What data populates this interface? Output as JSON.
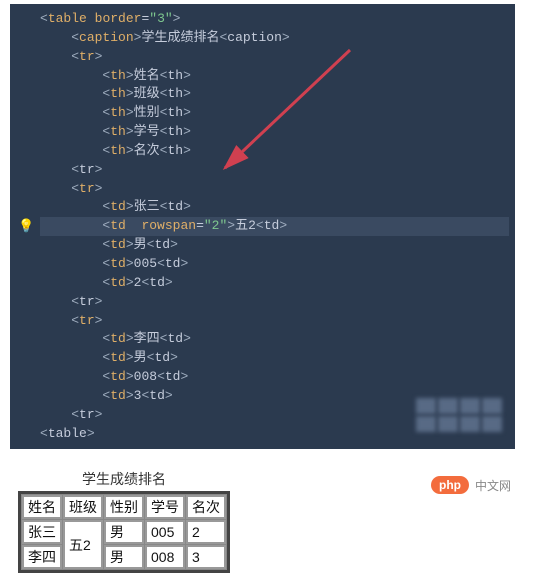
{
  "code": {
    "lines": [
      {
        "indent": 0,
        "html": "<_a><_t>table</_t> <_at>border</_at><_eq>=</_eq><_s>\"3\"</_s><_a2>"
      },
      {
        "indent": 1,
        "html": "<_a><_t>caption</_t><_a2><_x>学生成绩排名</_x><_a></<_t>caption</_t><_a2>"
      },
      {
        "indent": 1,
        "html": "<_a><_t>tr</_t><_a2>"
      },
      {
        "indent": 2,
        "html": "<_a><_t>th</_t><_a2><_x>姓名</_x><_a></<_t>th</_t><_a2>"
      },
      {
        "indent": 2,
        "html": "<_a><_t>th</_t><_a2><_x>班级</_x><_a></<_t>th</_t><_a2>"
      },
      {
        "indent": 2,
        "html": "<_a><_t>th</_t><_a2><_x>性别</_x><_a></<_t>th</_t><_a2>"
      },
      {
        "indent": 2,
        "html": "<_a><_t>th</_t><_a2><_x>学号</_x><_a></<_t>th</_t><_a2>"
      },
      {
        "indent": 2,
        "html": "<_a><_t>th</_t><_a2><_x>名次</_x><_a></<_t>th</_t><_a2>"
      },
      {
        "indent": 1,
        "html": "<_a></<_t>tr</_t><_a2>"
      },
      {
        "indent": 1,
        "html": "<_a><_t>tr</_t><_a2>"
      },
      {
        "indent": 2,
        "html": "<_a><_t>td</_t><_a2><_x>张三</_x><_a></<_t>td</_t><_a2>"
      },
      {
        "indent": 2,
        "html": "<_a><_t>td</_t>  <_at>rowspan</_at><_eq>=</_eq><_s>\"2\"</_s><_a2><_x>五2</_x><_a></<_t>td</_t><_a2>",
        "hl": true,
        "bulb": true
      },
      {
        "indent": 2,
        "html": "<_a><_t>td</_t><_a2><_x>男</_x><_a></<_t>td</_t><_a2>"
      },
      {
        "indent": 2,
        "html": "<_a><_t>td</_t><_a2><_x>005</_x><_a></<_t>td</_t><_a2>"
      },
      {
        "indent": 2,
        "html": "<_a><_t>td</_t><_a2><_x>2</_x><_a></<_t>td</_t><_a2>"
      },
      {
        "indent": 1,
        "html": "<_a></<_t>tr</_t><_a2>"
      },
      {
        "indent": 1,
        "html": "<_a><_t>tr</_t><_a2>"
      },
      {
        "indent": 2,
        "html": "<_a><_t>td</_t><_a2><_x>李四</_x><_a></<_t>td</_t><_a2>"
      },
      {
        "indent": 2,
        "html": "<_a><_t>td</_t><_a2><_x>男</_x><_a></<_t>td</_t><_a2>"
      },
      {
        "indent": 2,
        "html": "<_a><_t>td</_t><_a2><_x>008</_x><_a></<_t>td</_t><_a2>"
      },
      {
        "indent": 2,
        "html": "<_a><_t>td</_t><_a2><_x>3</_x><_a></<_t>td</_t><_a2>"
      },
      {
        "indent": 1,
        "html": "<_a></<_t>tr</_t><_a2>"
      },
      {
        "indent": 0,
        "html": "<_a></<_t>table</_t><_a2>"
      }
    ]
  },
  "rendered_table": {
    "caption": "学生成绩排名",
    "headers": [
      "姓名",
      "班级",
      "性别",
      "学号",
      "名次"
    ],
    "rows": [
      {
        "cells": [
          "张三",
          {
            "text": "五2",
            "rowspan": 2
          },
          "男",
          "005",
          "2"
        ]
      },
      {
        "cells": [
          "李四",
          "男",
          "008",
          "3"
        ]
      }
    ]
  },
  "brand": {
    "pill": "php",
    "text": "中文网"
  }
}
